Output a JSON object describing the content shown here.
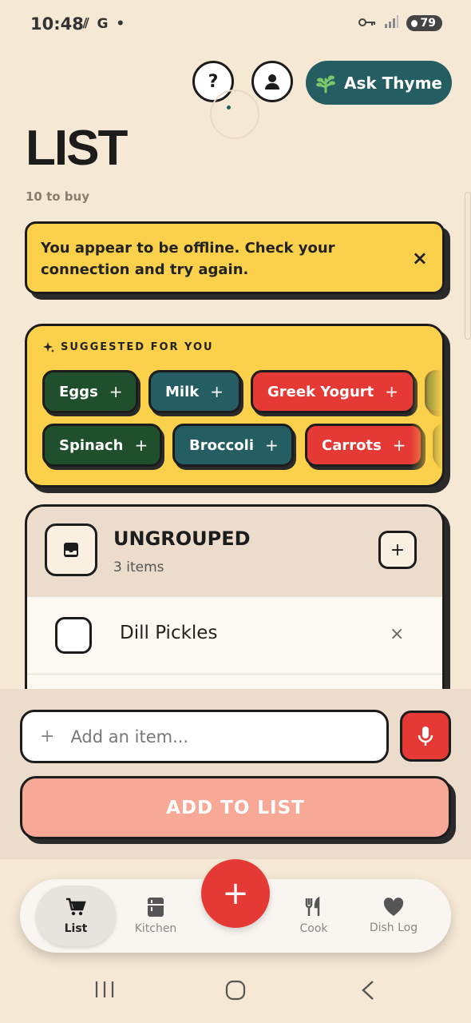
{
  "status_bar": {
    "time": "10:48",
    "left_icons": "⫽ G •",
    "battery": "79"
  },
  "header": {
    "help_label": "?",
    "ask_label": "Ask Thyme"
  },
  "page": {
    "title": "LIST",
    "count": "10 to buy"
  },
  "banner": {
    "message": "You appear to be offline. Check your connection and try again.",
    "close": "×"
  },
  "suggested": {
    "title": "SUGGESTED FOR YOU",
    "chips": [
      {
        "label": "Eggs"
      },
      {
        "label": "Milk"
      },
      {
        "label": "Greek Yogurt"
      },
      {
        "label": "Spinach"
      },
      {
        "label": "Broccoli"
      },
      {
        "label": "Carrots"
      }
    ],
    "plus": "+"
  },
  "group": {
    "name": "UNGROUPED",
    "count": "3 items",
    "add": "+",
    "items": [
      {
        "name": "Dill Pickles",
        "remove": "×"
      }
    ]
  },
  "composer": {
    "plus": "+",
    "placeholder": "Add an item...",
    "add_button": "ADD TO LIST"
  },
  "nav": {
    "items": [
      {
        "label": "List"
      },
      {
        "label": "Kitchen"
      },
      {
        "label": "Cook"
      },
      {
        "label": "Dish Log"
      }
    ],
    "fab": "+"
  },
  "colors": {
    "background": "#f5e8d5",
    "yellow": "#fbd14b",
    "teal": "#245e63",
    "green": "#1f4f2d",
    "red": "#e53935",
    "salmon": "#f7a896"
  }
}
